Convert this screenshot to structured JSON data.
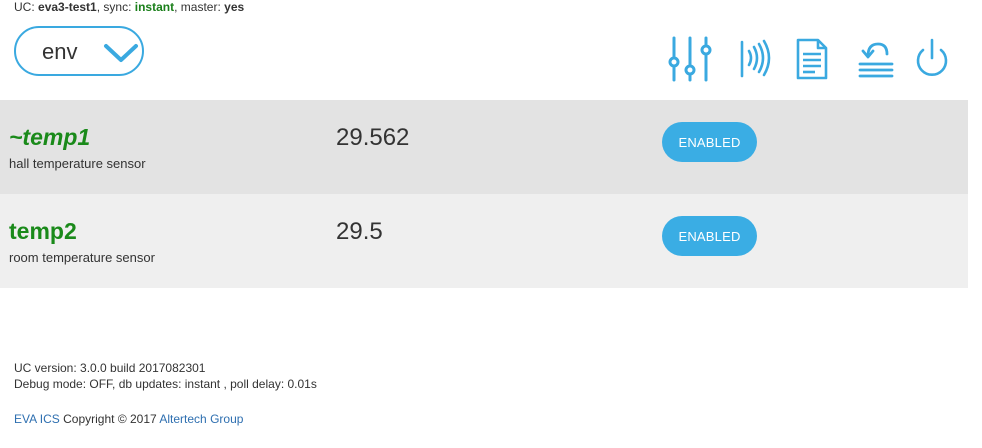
{
  "status": {
    "uc_label": "UC:",
    "uc_name": "eva3-test1",
    "sync_label": ", sync:",
    "sync_value": "instant",
    "master_label": ", master:",
    "master_value": "yes"
  },
  "group_select": {
    "value": "env"
  },
  "toolbar": {
    "icons": [
      "sliders-icon",
      "broadcast-icon",
      "log-document-icon",
      "restore-icon",
      "power-icon"
    ],
    "accent": "#3aa9e0"
  },
  "sensors": [
    {
      "name": "~temp1",
      "description": "hall temperature sensor",
      "value": "29.562",
      "status": "ENABLED"
    },
    {
      "name": "temp2",
      "description": "room temperature sensor",
      "value": "29.5",
      "status": "ENABLED"
    }
  ],
  "footer": {
    "version": "UC version: 3.0.0 build 2017082301",
    "debug": "Debug mode: OFF, db updates: instant , poll delay: 0.01s",
    "product_link": "EVA ICS",
    "copyright": " Copyright © 2017 ",
    "company_link": "Altertech Group"
  },
  "colors": {
    "accent": "#3aa9e0",
    "sensor_name": "#1a8a1a",
    "row1_bg": "#e3e3e3",
    "row2_bg": "#efefef"
  }
}
